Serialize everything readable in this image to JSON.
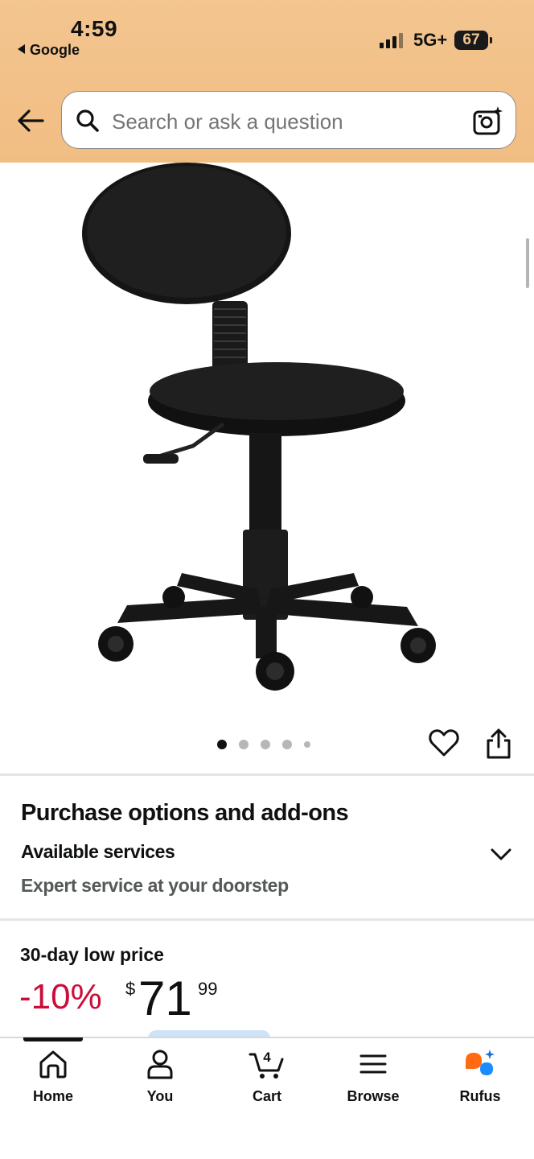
{
  "status_bar": {
    "time": "4:59",
    "back_app": "Google",
    "network": "5G+",
    "battery": "67"
  },
  "search": {
    "placeholder": "Search or ask a question"
  },
  "carousel": {
    "dot_count": 5,
    "active_index": 0
  },
  "purchase_options": {
    "title": "Purchase options and add-ons",
    "services_label": "Available services",
    "services_desc": "Expert service at your doorstep"
  },
  "price": {
    "deal_label": "30-day low price",
    "discount": "-10%",
    "currency_symbol": "$",
    "whole": "71",
    "fraction": "99"
  },
  "bottom_nav": {
    "items": [
      {
        "label": "Home",
        "icon": "home-icon"
      },
      {
        "label": "You",
        "icon": "person-icon"
      },
      {
        "label": "Cart",
        "icon": "cart-icon",
        "badge": "4"
      },
      {
        "label": "Browse",
        "icon": "menu-icon"
      },
      {
        "label": "Rufus",
        "icon": "rufus-icon"
      }
    ],
    "active_index": 0
  },
  "colors": {
    "header_bg": "#f3c58f",
    "discount_red": "#cc0c39",
    "rufus_orange": "#ff6a13",
    "rufus_blue": "#1a8cff"
  }
}
